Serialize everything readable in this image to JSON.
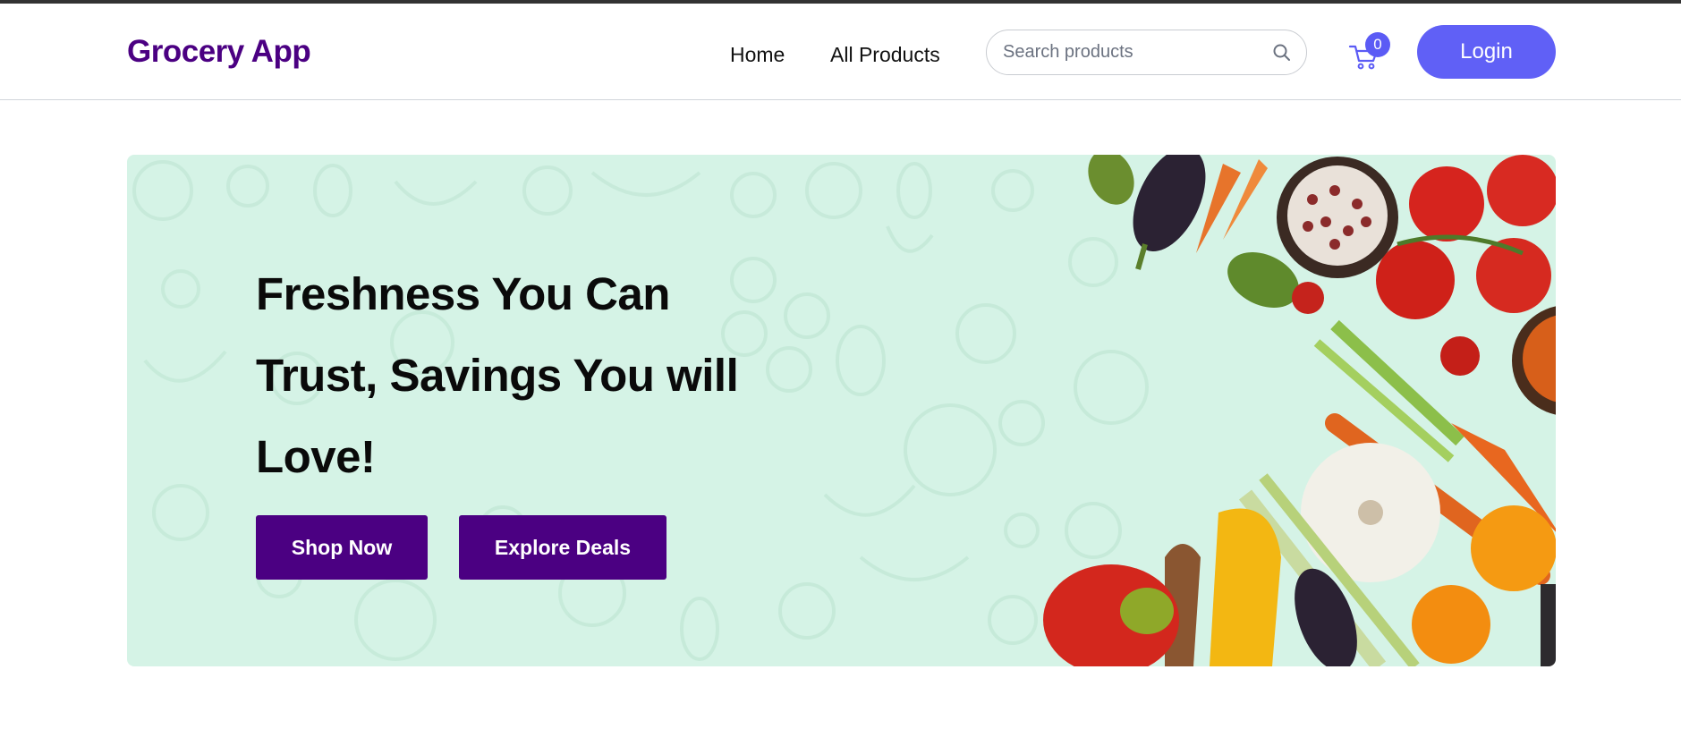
{
  "brand": {
    "name": "Grocery App"
  },
  "nav": {
    "links": [
      {
        "label": "Home"
      },
      {
        "label": "All Products"
      }
    ]
  },
  "search": {
    "placeholder": "Search products",
    "icon": "search-icon"
  },
  "cart": {
    "icon": "cart-icon",
    "count": "0"
  },
  "login": {
    "label": "Login"
  },
  "hero": {
    "title": "Freshness You Can Trust, Savings You will Love!",
    "buttons": [
      {
        "label": "Shop Now"
      },
      {
        "label": "Explore Deals"
      }
    ]
  },
  "colors": {
    "brand": "#4b0082",
    "accent": "#6060f6",
    "hero_bg": "#d5f3e6"
  }
}
